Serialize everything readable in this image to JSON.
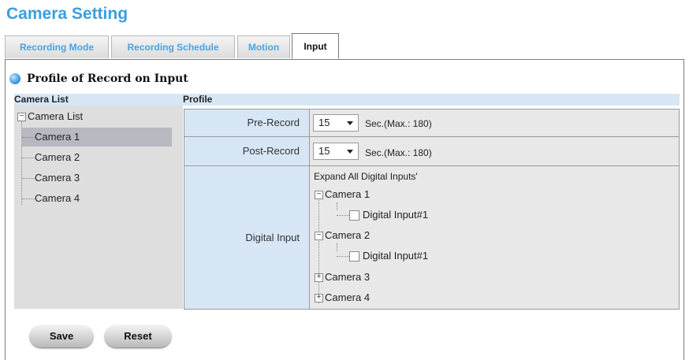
{
  "page": {
    "title": "Camera Setting"
  },
  "tabs": [
    {
      "label": "Recording Mode",
      "active": false
    },
    {
      "label": "Recording Schedule",
      "active": false
    },
    {
      "label": "Motion",
      "active": false
    },
    {
      "label": "Input",
      "active": true
    }
  ],
  "section": {
    "title": "Profile of Record on Input"
  },
  "headers": {
    "camera_list": "Camera List",
    "profile": "Profile"
  },
  "camera_tree": {
    "root": "Camera List",
    "items": [
      "Camera 1",
      "Camera 2",
      "Camera 3",
      "Camera 4"
    ],
    "selected": "Camera 1"
  },
  "profile": {
    "pre_record": {
      "label": "Pre-Record",
      "value": "15",
      "hint": "Sec.(Max.: 180)"
    },
    "post_record": {
      "label": "Post-Record",
      "value": "15",
      "hint": "Sec.(Max.: 180)"
    },
    "digital_input": {
      "label": "Digital Input",
      "expand_all": "Expand All Digital Inputs'",
      "cameras": [
        {
          "name": "Camera 1",
          "expanded": true,
          "input": "Digital Input#1",
          "checked": false
        },
        {
          "name": "Camera 2",
          "expanded": true,
          "input": "Digital Input#1",
          "checked": false
        },
        {
          "name": "Camera 3",
          "expanded": false
        },
        {
          "name": "Camera 4",
          "expanded": false
        }
      ]
    }
  },
  "buttons": {
    "save": "Save",
    "reset": "Reset"
  }
}
